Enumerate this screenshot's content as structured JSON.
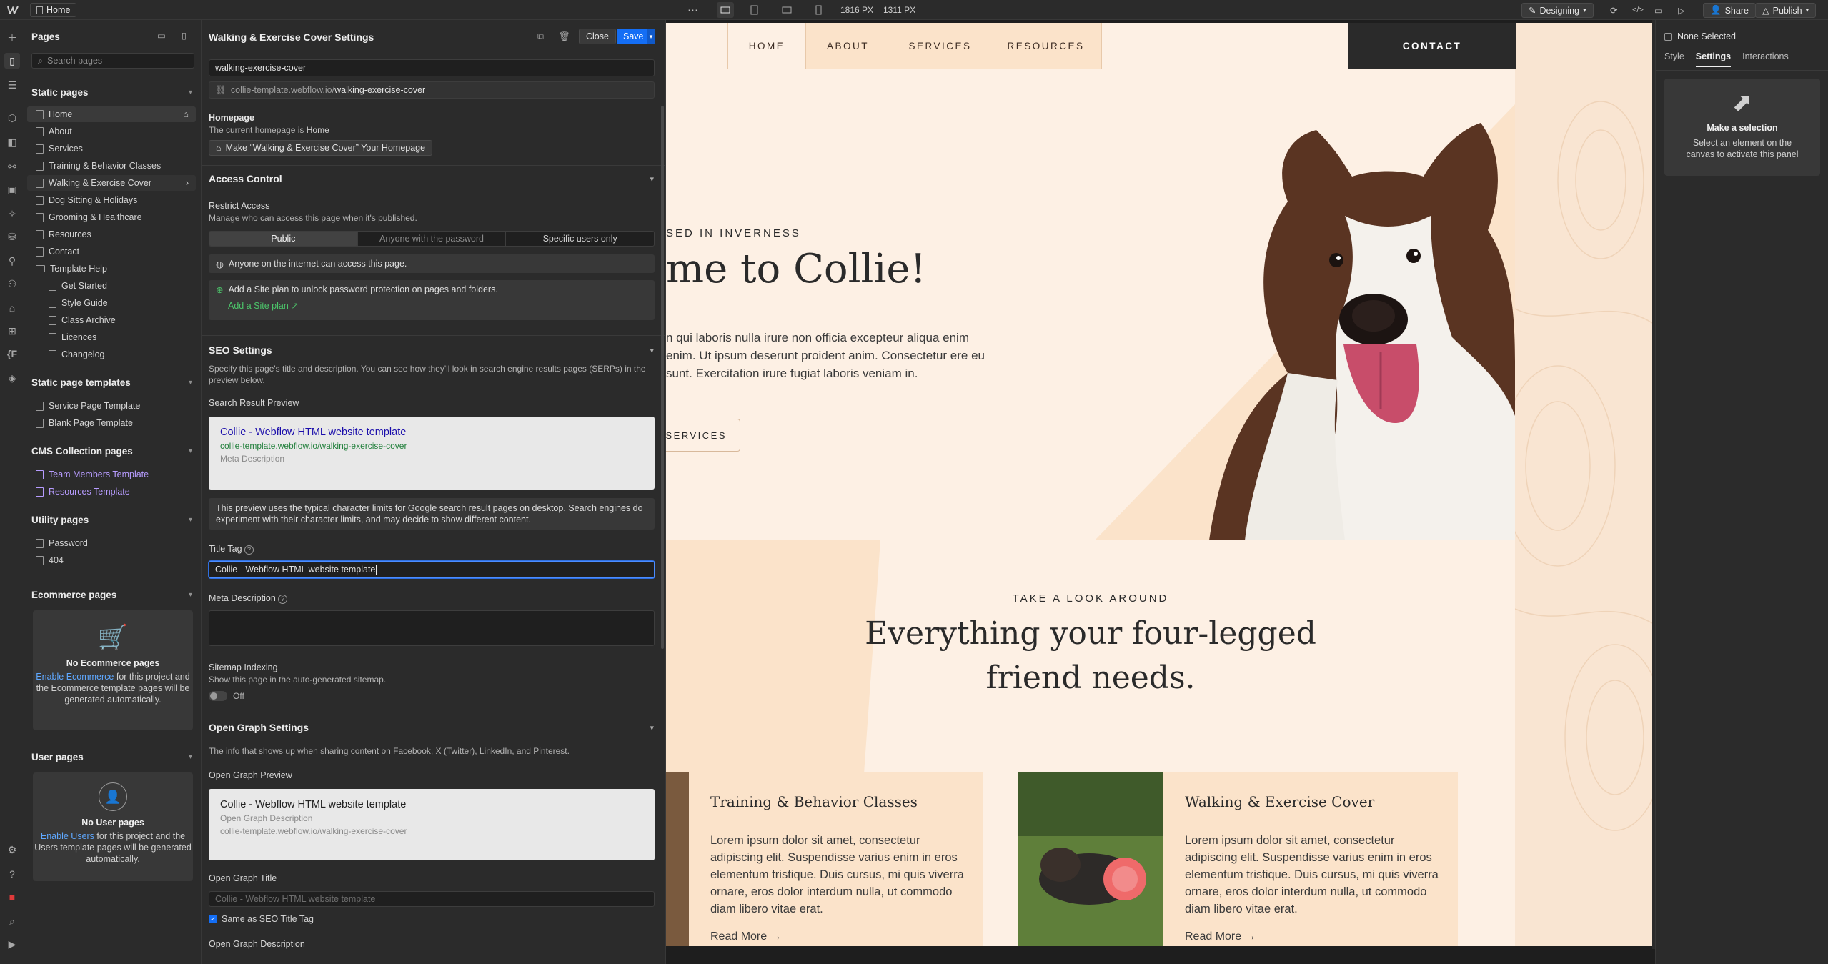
{
  "topbar": {
    "home_label": "Home",
    "width_label": "1816 PX",
    "height_label": "1311 PX",
    "mode_label": "Designing",
    "share_label": "Share",
    "publish_label": "Publish"
  },
  "pages_panel": {
    "title": "Pages",
    "search_placeholder": "Search pages",
    "static_header": "Static pages",
    "static_pages": [
      "Home",
      "About",
      "Services",
      "Training & Behavior Classes",
      "Walking & Exercise Cover",
      "Dog Sitting & Holidays",
      "Grooming & Healthcare",
      "Resources",
      "Contact",
      "Template Help"
    ],
    "template_help_pages": [
      "Get Started",
      "Style Guide",
      "Class Archive",
      "Licences",
      "Changelog"
    ],
    "templates_header": "Static page templates",
    "template_pages": [
      "Service Page Template",
      "Blank Page Template"
    ],
    "cms_header": "CMS Collection pages",
    "cms_pages": [
      "Team Members Template",
      "Resources Template"
    ],
    "utility_header": "Utility pages",
    "utility_pages": [
      "Password",
      "404"
    ],
    "ecommerce_header": "Ecommerce pages",
    "ecommerce_empty_title": "No Ecommerce pages",
    "ecommerce_link": "Enable Ecommerce",
    "ecommerce_text": " for this project and the Ecommerce template pages will be generated automatically.",
    "user_header": "User pages",
    "user_empty_title": "No User pages",
    "user_link": "Enable Users",
    "user_text": " for this project and the Users template pages will be generated automatically."
  },
  "settings": {
    "title": "Walking & Exercise Cover Settings",
    "close_label": "Close",
    "save_label": "Save",
    "slug_value": "walking-exercise-cover",
    "url_prefix": "collie-template.webflow.io/",
    "url_slug": "walking-exercise-cover",
    "homepage_label": "Homepage",
    "homepage_current": "The current homepage is ",
    "homepage_link": "Home",
    "make_homepage_label": "Make “Walking & Exercise Cover” Your Homepage",
    "access_header": "Access Control",
    "restrict_label": "Restrict Access",
    "restrict_desc": "Manage who can access this page when it's published.",
    "access_options": [
      "Public",
      "Anyone with the password",
      "Specific users only"
    ],
    "access_note": "Anyone on the internet can access this page.",
    "siteplan_note": "Add a Site plan to unlock password protection on pages and folders.",
    "siteplan_link": "Add a Site plan ↗",
    "seo_header": "SEO Settings",
    "seo_desc": "Specify this page's title and description. You can see how they'll look in search engine results pages (SERPs) in the preview below.",
    "serp_label": "Search Result Preview",
    "serp_title": "Collie - Webflow HTML website template",
    "serp_url": "collie-template.webflow.io/walking-exercise-cover",
    "serp_desc": "Meta Description",
    "serp_note": "This preview uses the typical character limits for Google search result pages on desktop. Search engines do experiment with their character limits, and may decide to show different content.",
    "title_tag_label": "Title Tag",
    "title_tag_value": "Collie - Webflow HTML website template",
    "meta_desc_label": "Meta Description",
    "sitemap_label": "Sitemap Indexing",
    "sitemap_desc": "Show this page in the auto-generated sitemap.",
    "sitemap_state": "Off",
    "og_header": "Open Graph Settings",
    "og_desc": "The info that shows up when sharing content on Facebook, X (Twitter), LinkedIn, and Pinterest.",
    "og_preview_label": "Open Graph Preview",
    "og_title": "Collie - Webflow HTML website template",
    "og_desc_placeholder": "Open Graph Description",
    "og_url": "collie-template.webflow.io/walking-exercise-cover",
    "og_title_label": "Open Graph Title",
    "og_title_placeholder": "Collie - Webflow HTML website template",
    "og_same_label": "Same as SEO Title Tag",
    "og_description_label": "Open Graph Description"
  },
  "site": {
    "nav": [
      "HOME",
      "ABOUT",
      "SERVICES",
      "RESOURCES",
      "CONTACT"
    ],
    "eyebrow": "SED IN INVERNESS",
    "headline": "me to Collie!",
    "body": "n qui laboris nulla irure non officia excepteur aliqua enim enim. Ut ipsum deserunt proident anim. Consectetur ere eu sunt. Exercitation irure fugiat laboris veniam in.",
    "cta": "SERVICES",
    "section_eyebrow": "TAKE A LOOK AROUND",
    "section_title_1": "Everything your four-legged",
    "section_title_2": "friend needs.",
    "card1_title": "Training & Behavior Classes",
    "card2_title": "Walking & Exercise Cover",
    "card_body": "Lorem ipsum dolor sit amet, consectetur adipiscing elit. Suspendisse varius enim in eros elementum tristique. Duis cursus, mi quis viverra ornare, eros dolor interdum nulla, ut commodo diam libero vitae erat.",
    "read_more": "Read More →"
  },
  "right_panel": {
    "none_selected": "None Selected",
    "tabs": [
      "Style",
      "Settings",
      "Interactions"
    ],
    "empty_title": "Make a selection",
    "empty_desc": "Select an element on the canvas to activate this panel"
  },
  "colors": {
    "accent": "#146ef5",
    "site_bg": "#fdf0e4",
    "site_peach": "#fbe3ca",
    "cms_purple": "#b79cff"
  }
}
